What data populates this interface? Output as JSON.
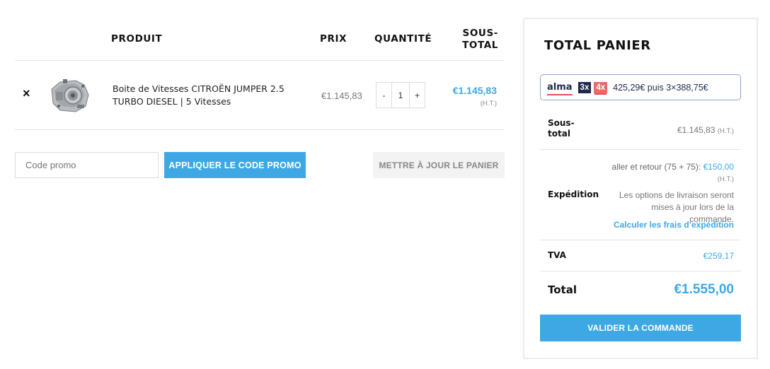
{
  "cart": {
    "headers": {
      "product": "PRODUIT",
      "price": "PRIX",
      "quantity": "QUANTITÉ",
      "subtotal_line1": "SOUS-",
      "subtotal_line2": "TOTAL"
    },
    "items": [
      {
        "remove_glyph": "×",
        "thumbnail_icon": "gearbox-image",
        "name": "Boite de Vitesses CITROËN JUMPER 2.5 TURBO DIESEL | 5 Vitesses",
        "price": "€1.145,83",
        "qty_minus": "-",
        "quantity": "1",
        "qty_plus": "+",
        "subtotal": "€1.145,83",
        "subtotal_note": "(H.T.)"
      }
    ],
    "promo": {
      "placeholder": "Code promo",
      "apply_label": "APPLIQUER LE CODE PROMO"
    },
    "update_label": "METTRE À JOUR LE PANIER"
  },
  "totals": {
    "title": "TOTAL PANIER",
    "alma": {
      "logo": "alma",
      "option_3x": "3x",
      "option_4x": "4x",
      "text": "425,29€ puis 3×388,75€"
    },
    "subtotal": {
      "label": "Sous-total",
      "value": "€1.145,83",
      "note": "(H.T.)"
    },
    "shipping": {
      "label": "Expédition",
      "rate_text": "aller et retour (75 + 75): ",
      "rate_value": "€150,00",
      "rate_note": "(H.T.)",
      "note": "Les options de livraison seront mises à jour lors de la commande.",
      "calculate_link": "Calculer les frais d’expédition"
    },
    "tva": {
      "label": "TVA",
      "value": "€259,17"
    },
    "total": {
      "label": "Total",
      "value": "€1.555,00"
    },
    "checkout_label": "VALIDER LA COMMANDE"
  },
  "colors": {
    "accent": "#3ea8e5",
    "alma_navy": "#1e2a4a",
    "alma_red": "#e94e4e"
  }
}
